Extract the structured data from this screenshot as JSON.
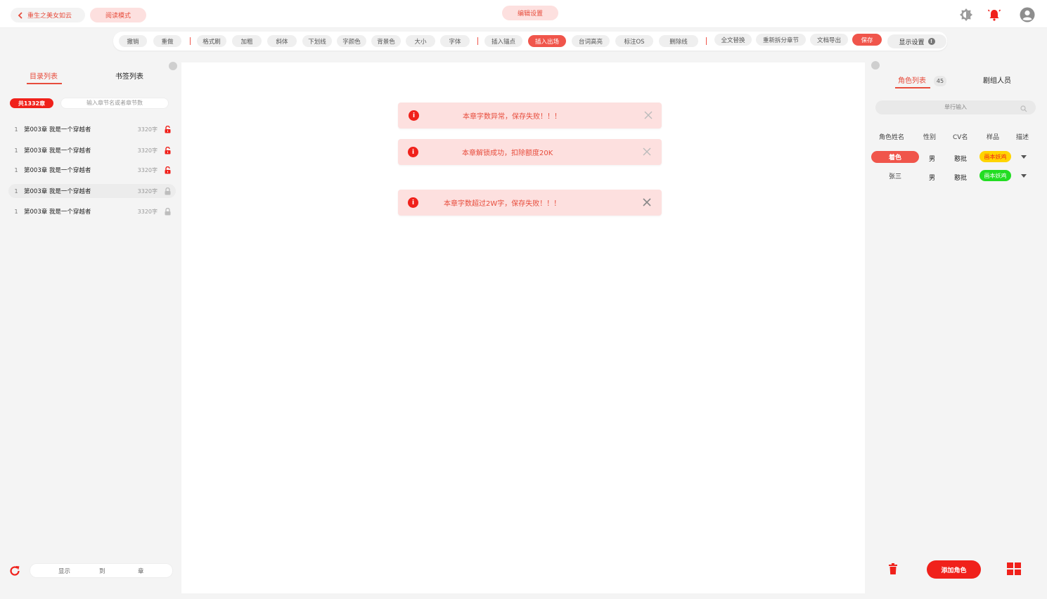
{
  "header": {
    "back_label": "重生之美女如云",
    "read_mode_label": "阅读模式",
    "edit_settings_label": "编辑设置",
    "accent": "#f0211b"
  },
  "toolbar": {
    "buttons": [
      "撤销",
      "重做",
      "格式刷",
      "加粗",
      "斜体",
      "下划线",
      "字颜色",
      "背景色",
      "大小",
      "字体",
      "插入锚点",
      "插入出场",
      "台词高亮",
      "标注OS",
      "删除线",
      "全文替换",
      "重新拆分章节",
      "文档导出",
      "保存"
    ],
    "display_settings_label": "显示设置"
  },
  "left": {
    "tabs": [
      "目录列表",
      "书签列表"
    ],
    "count_badge": "共1332章",
    "search_placeholder": "输入章节名或者章节数",
    "chapters": [
      {
        "num": "1",
        "title": "第003章 我是一个穿越者",
        "words": "3320字",
        "lock": "unlocked-red"
      },
      {
        "num": "1",
        "title": "第003章 我是一个穿越者",
        "words": "3320字",
        "lock": "unlocked-red"
      },
      {
        "num": "1",
        "title": "第003章 我是一个穿越者",
        "words": "3320字",
        "lock": "unlocked-red"
      },
      {
        "num": "1",
        "title": "第003章 我是一个穿越者",
        "words": "3320字",
        "lock": "locked-grey"
      },
      {
        "num": "1",
        "title": "第003章 我是一个穿越者",
        "words": "3320字",
        "lock": "locked-grey"
      }
    ],
    "pager": [
      "显示",
      "到",
      "章"
    ]
  },
  "toasts": [
    "本章字数异常，保存失败！！！",
    "本章解锁成功，扣除额度20K",
    "本章字数超过2W字，保存失败！！！"
  ],
  "right": {
    "tabs": [
      "角色列表",
      "剧组人员"
    ],
    "role_count": "45",
    "search_placeholder": "单行输入",
    "columns": [
      "角色姓名",
      "性别",
      "CV名",
      "样品",
      "描述"
    ],
    "rows": [
      {
        "name": "着色",
        "gender": "男",
        "cv": "憨批",
        "sample": "画本妖鸡",
        "sample_color": "#ffd400"
      },
      {
        "name": "张三",
        "gender": "男",
        "cv": "憨批",
        "sample": "画本妖鸡",
        "sample_color": "#22dd22"
      }
    ],
    "add_role_label": "添加角色"
  }
}
